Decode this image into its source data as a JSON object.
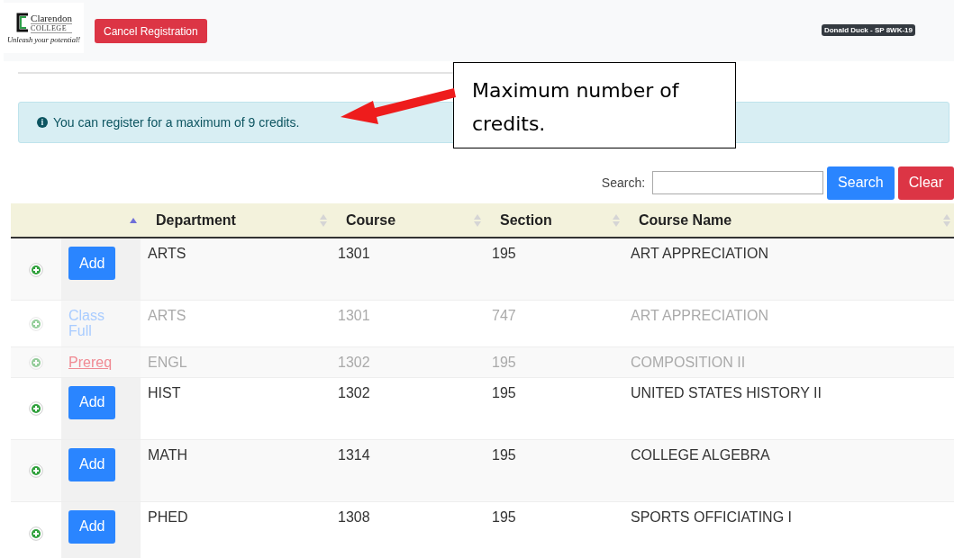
{
  "header": {
    "logo": {
      "name": "Clarendon",
      "subtitle": "COLLEGE",
      "tagline": "Unleash your potential!"
    },
    "cancel_button": "Cancel Registration",
    "user_badge": "Donald Duck - SP 8WK-19"
  },
  "alert": {
    "icon": "i",
    "text": "You can register for a maximum of 9 credits."
  },
  "callout": {
    "text": "Maximum number of credits."
  },
  "search": {
    "label": "Search:",
    "search_button": "Search",
    "clear_button": "Clear"
  },
  "table": {
    "columns": [
      {
        "sorted": true
      },
      {
        "label": "Department",
        "sorted": false
      },
      {
        "label": "Course",
        "sorted": false
      },
      {
        "label": "Section",
        "sorted": false
      },
      {
        "label": "Course Name",
        "sorted": false
      }
    ],
    "rows": [
      {
        "kind": "add",
        "action": "Add",
        "disabled": false,
        "department": "ARTS",
        "course": "1301",
        "section": "195",
        "course_name": "ART APPRECIATION"
      },
      {
        "kind": "full",
        "action": "Class Full",
        "disabled": true,
        "department": "ARTS",
        "course": "1301",
        "section": "747",
        "course_name": "ART APPRECIATION"
      },
      {
        "kind": "prereq",
        "action": "Prereq",
        "disabled": true,
        "department": "ENGL",
        "course": "1302",
        "section": "195",
        "course_name": "COMPOSITION II"
      },
      {
        "kind": "add",
        "action": "Add",
        "disabled": false,
        "department": "HIST",
        "course": "1302",
        "section": "195",
        "course_name": "UNITED STATES HISTORY II"
      },
      {
        "kind": "add",
        "action": "Add",
        "disabled": false,
        "department": "MATH",
        "course": "1314",
        "section": "195",
        "course_name": "COLLEGE ALGEBRA"
      },
      {
        "kind": "add",
        "action": "Add",
        "disabled": false,
        "department": "PHED",
        "course": "1308",
        "section": "195",
        "course_name": "SPORTS OFFICIATING I"
      }
    ]
  }
}
